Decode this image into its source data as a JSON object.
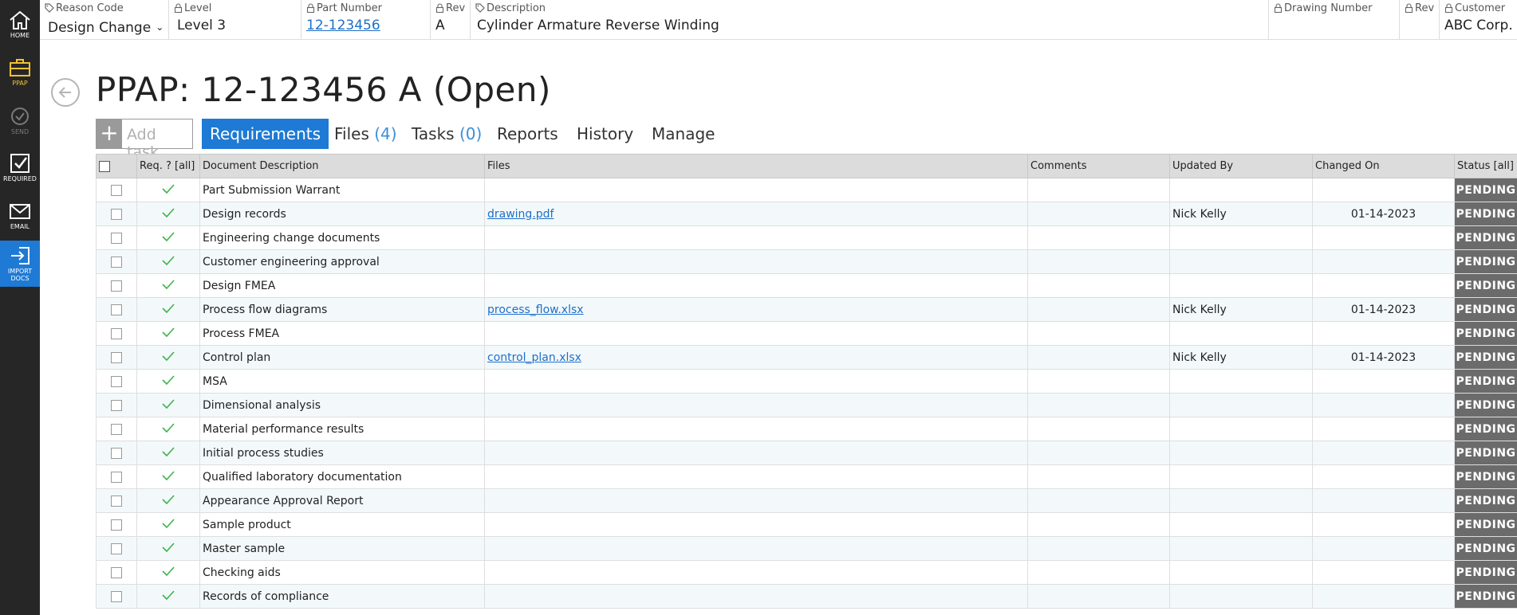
{
  "sidebar": {
    "items": [
      {
        "label": "HOME",
        "icon": "home-icon"
      },
      {
        "label": "PPAP",
        "icon": "briefcase-icon"
      },
      {
        "label": "SEND",
        "icon": "send-check-icon"
      },
      {
        "label": "REQUIRED",
        "icon": "checkbox-icon"
      },
      {
        "label": "EMAIL",
        "icon": "envelope-icon"
      },
      {
        "label": "IMPORT DOCS",
        "icon": "import-icon"
      }
    ]
  },
  "header": {
    "reason_code": {
      "label": "Reason Code",
      "value": "Design Change"
    },
    "level": {
      "label": "Level",
      "value": "Level 3"
    },
    "part_number": {
      "label": "Part Number",
      "value": "12-123456"
    },
    "rev": {
      "label": "Rev",
      "value": "A"
    },
    "description": {
      "label": "Description",
      "value": "Cylinder Armature Reverse Winding"
    },
    "drawing_number": {
      "label": "Drawing Number",
      "value": ""
    },
    "rev2": {
      "label": "Rev",
      "value": ""
    },
    "customer": {
      "label": "Customer",
      "value": "ABC Corp."
    }
  },
  "page": {
    "title": "PPAP: 12-123456 A (Open)"
  },
  "toolbar": {
    "add_task": "Add task",
    "tabs": [
      {
        "label": "Requirements",
        "count": ""
      },
      {
        "label": "Files",
        "count": "(4)"
      },
      {
        "label": "Tasks",
        "count": "(0)"
      },
      {
        "label": "Reports",
        "count": ""
      },
      {
        "label": "History",
        "count": ""
      },
      {
        "label": "Manage",
        "count": ""
      }
    ]
  },
  "table": {
    "columns": [
      "Req. ? [all]",
      "Document Description",
      "Files",
      "Comments",
      "Updated By",
      "Changed On",
      "Status [all]"
    ],
    "rows": [
      {
        "description": "Part Submission Warrant",
        "file": "",
        "comments": "",
        "updated_by": "",
        "changed_on": "",
        "status": "PENDING"
      },
      {
        "description": "Design records",
        "file": "drawing.pdf",
        "comments": "",
        "updated_by": "Nick Kelly",
        "changed_on": "01-14-2023",
        "status": "PENDING"
      },
      {
        "description": "Engineering change documents",
        "file": "",
        "comments": "",
        "updated_by": "",
        "changed_on": "",
        "status": "PENDING"
      },
      {
        "description": "Customer engineering approval",
        "file": "",
        "comments": "",
        "updated_by": "",
        "changed_on": "",
        "status": "PENDING"
      },
      {
        "description": "Design FMEA",
        "file": "",
        "comments": "",
        "updated_by": "",
        "changed_on": "",
        "status": "PENDING"
      },
      {
        "description": "Process flow diagrams",
        "file": "process_flow.xlsx",
        "comments": "",
        "updated_by": "Nick Kelly",
        "changed_on": "01-14-2023",
        "status": "PENDING"
      },
      {
        "description": "Process FMEA",
        "file": "",
        "comments": "",
        "updated_by": "",
        "changed_on": "",
        "status": "PENDING"
      },
      {
        "description": "Control plan",
        "file": "control_plan.xlsx",
        "comments": "",
        "updated_by": "Nick Kelly",
        "changed_on": "01-14-2023",
        "status": "PENDING"
      },
      {
        "description": "MSA",
        "file": "",
        "comments": "",
        "updated_by": "",
        "changed_on": "",
        "status": "PENDING"
      },
      {
        "description": "Dimensional analysis",
        "file": "",
        "comments": "",
        "updated_by": "",
        "changed_on": "",
        "status": "PENDING"
      },
      {
        "description": "Material performance results",
        "file": "",
        "comments": "",
        "updated_by": "",
        "changed_on": "",
        "status": "PENDING"
      },
      {
        "description": "Initial process studies",
        "file": "",
        "comments": "",
        "updated_by": "",
        "changed_on": "",
        "status": "PENDING"
      },
      {
        "description": "Qualified laboratory documentation",
        "file": "",
        "comments": "",
        "updated_by": "",
        "changed_on": "",
        "status": "PENDING"
      },
      {
        "description": "Appearance Approval Report",
        "file": "",
        "comments": "",
        "updated_by": "",
        "changed_on": "",
        "status": "PENDING"
      },
      {
        "description": "Sample product",
        "file": "",
        "comments": "",
        "updated_by": "",
        "changed_on": "",
        "status": "PENDING"
      },
      {
        "description": "Master sample",
        "file": "",
        "comments": "",
        "updated_by": "",
        "changed_on": "",
        "status": "PENDING"
      },
      {
        "description": "Checking aids",
        "file": "",
        "comments": "",
        "updated_by": "",
        "changed_on": "",
        "status": "PENDING"
      },
      {
        "description": "Records of compliance",
        "file": "",
        "comments": "",
        "updated_by": "",
        "changed_on": "",
        "status": "PENDING"
      }
    ]
  },
  "colors": {
    "sidebar_bg": "#262626",
    "accent": "#1e7ad4",
    "ppap_highlight": "#f1c232",
    "check_green": "#3cb44b",
    "status_pending_bg": "#6b6b6b",
    "row_alt": "#f3f9fb"
  }
}
